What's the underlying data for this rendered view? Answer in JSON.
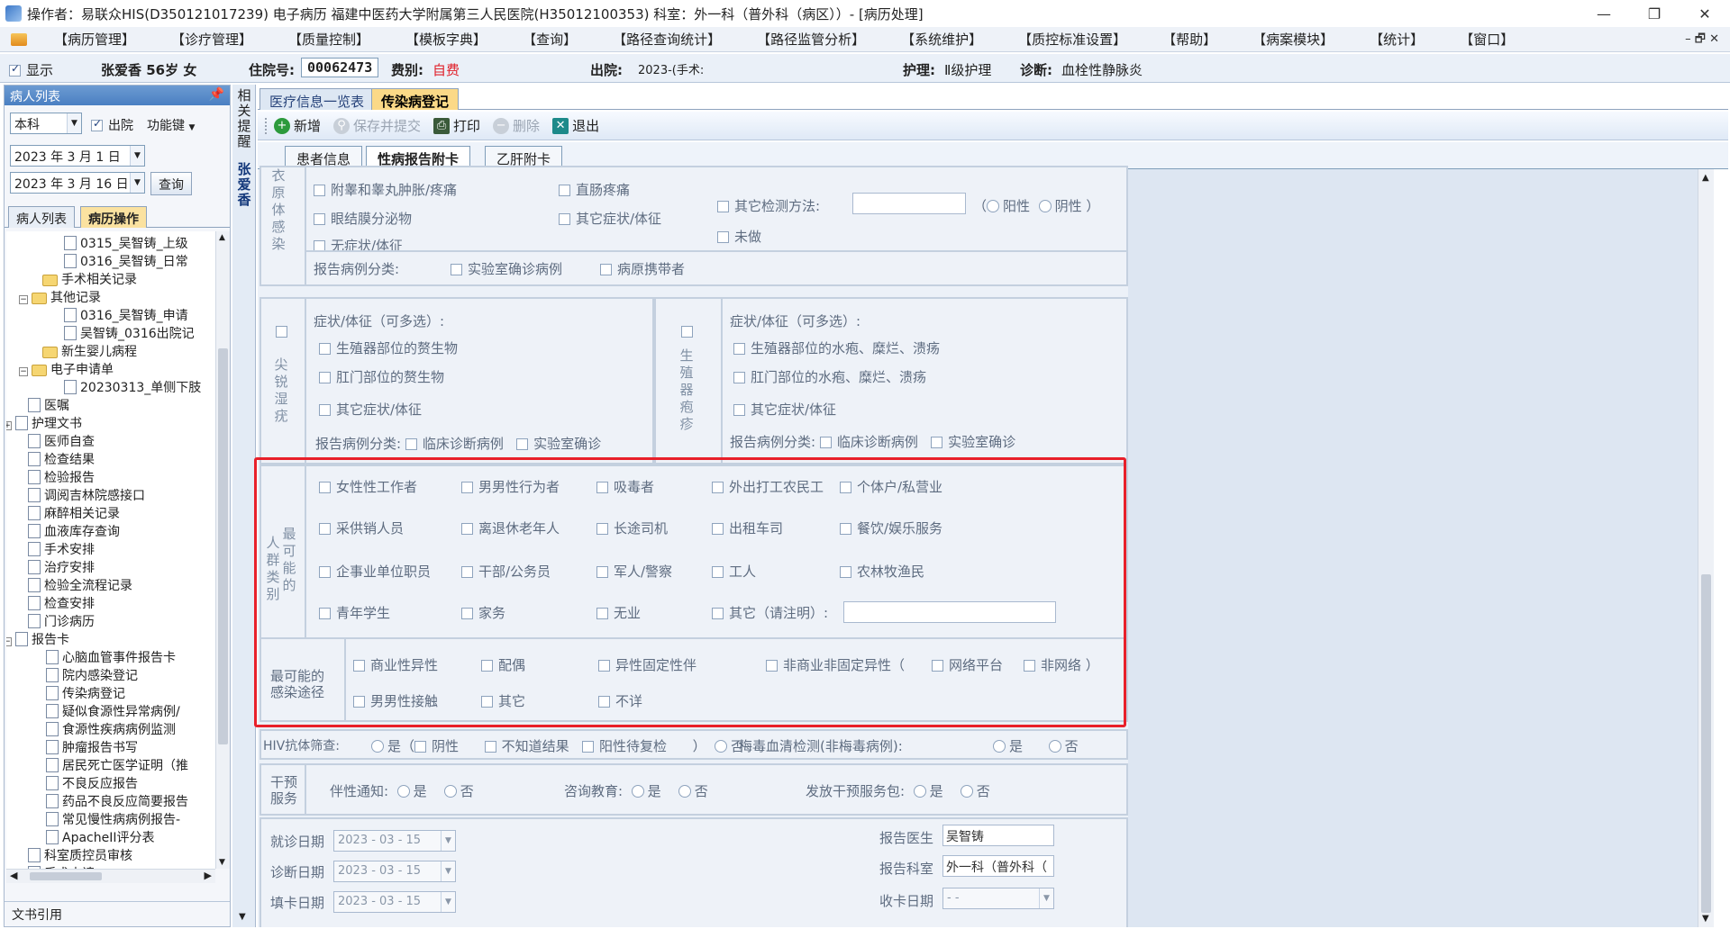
{
  "titlebar": {
    "text": "操作者：易联众HIS(D350121017239) 电子病历  福建中医药大学附属第三人民医院(H35012100353)  科室：外一科（普外科（病区））- [病历处理]",
    "min": "—",
    "restore": "❐",
    "close": "✕"
  },
  "menu": [
    "【病历管理】",
    "【诊疗管理】",
    "【质量控制】",
    "【模板字典】",
    "【查询】",
    "【路径查询统计】",
    "【路径监管分析】",
    "【系统维护】",
    "【质控标准设置】",
    "【帮助】",
    "【病案模块】",
    "【统计】",
    "【窗口】"
  ],
  "mdi_controls": "–  🗗  ✕",
  "patient": {
    "show_label": "显示",
    "name_age": "张爱香  56岁  女",
    "inpatient_no_label": "住院号:",
    "inpatient_no": "00062473",
    "fee_label": "费别:",
    "fee": "自费",
    "discharge_label": "出院:",
    "discharge": "2023-(手术:",
    "nursing_label": "护理:",
    "nursing": "Ⅱ级护理",
    "diagnosis_label": "诊断:",
    "diagnosis": "血栓性静脉炎"
  },
  "left_panel": {
    "title": "病人列表",
    "pin": "📌",
    "dept": "本科",
    "discharged_label": "出院",
    "func_key": "功能键",
    "date_from": "2023 年  3 月  1 日",
    "date_to": "2023 年  3 月 16 日",
    "query": "查询",
    "tab1": "病人列表",
    "tab2": "病历操作",
    "footer": "文书引用",
    "tree": [
      "0315_吴智铸_上级",
      "0316_吴智铸_日常",
      "手术相关记录",
      "其他记录",
      "0316_吴智铸_申请",
      "吴智铸_0316出院记",
      "新生婴儿病程",
      "电子申请单",
      "20230313_单侧下肢",
      "医嘱",
      "护理文书",
      "医师自查",
      "检查结果",
      "检验报告",
      "调阅吉林院感接口",
      "麻醉相关记录",
      "血液库存查询",
      "手术安排",
      "治疗安排",
      "检验全流程记录",
      "检查安排",
      "门诊病历",
      "报告卡",
      "心脑血管事件报告卡",
      "院内感染登记",
      "传染病登记",
      "疑似食源性异常病例/",
      "食源性疾病病例监测",
      "肿瘤报告书写",
      "居民死亡医学证明（推",
      "不良反应报告",
      "药品不良反应简要报告",
      "常见慢性病病例报告-",
      "ApacheII评分表",
      "科室质控员审核",
      "手术申请"
    ]
  },
  "side_strip": {
    "reminder": "相关提醒",
    "patient": "张爱香"
  },
  "main_tabs": [
    "医疗信息一览表",
    "传染病登记"
  ],
  "toolbar": {
    "new": "新增",
    "save": "保存并提交",
    "print": "打印",
    "delete": "删除",
    "exit": "退出"
  },
  "sub_tabs": [
    "患者信息",
    "性病报告附卡",
    "乙肝附卡"
  ],
  "form": {
    "chlamydia": {
      "title": "衣原体感染",
      "s1": "附睾和睾丸肿胀/疼痛",
      "s2": "直肠疼痛",
      "s3": "眼结膜分泌物",
      "s4": "其它症状/体征",
      "s5": "无症状/体征",
      "test_label": "其它检测方法:",
      "positive": "阳性",
      "negative": "阴性",
      "paren_open": "（",
      "paren_close": "）",
      "not_done": "未做",
      "class_label": "报告病例分类:",
      "c1": "实验室确诊病例",
      "c2": "病原携带者"
    },
    "condyloma": {
      "title": "尖锐湿疣",
      "sym_label": "症状/体征（可多选）:",
      "s1": "生殖器部位的赘生物",
      "s2": "肛门部位的赘生物",
      "s3": "其它症状/体征",
      "class_label": "报告病例分类:",
      "c1": "临床诊断病例",
      "c2": "实验室确诊"
    },
    "herpes": {
      "title": "生殖器疱疹",
      "sym_label": "症状/体征（可多选）:",
      "s1": "生殖器部位的水疱、糜烂、溃疡",
      "s2": "肛门部位的水疱、糜烂、溃疡",
      "s3": "其它症状/体征",
      "class_label": "报告病例分类:",
      "c1": "临床诊断病例",
      "c2": "实验室确诊"
    },
    "population": {
      "title_a": "人群类别",
      "title_b": "最可能的",
      "items": [
        "女性性工作者",
        "男男性行为者",
        "吸毒者",
        "外出打工农民工",
        "个体户/私营业",
        "采供销人员",
        "离退休老年人",
        "长途司机",
        "出租车司",
        "餐饮/娱乐服务",
        "企事业单位职员",
        "干部/公务员",
        "军人/警察",
        "工人",
        "农林牧渔民",
        "青年学生",
        "家务",
        "无业",
        "其它（请注明）:"
      ]
    },
    "route": {
      "title": "最可能的感染途径",
      "items": [
        "商业性异性",
        "配偶",
        "异性固定性伴",
        "非商业非固定异性（",
        "网络平台",
        "非网络  ）",
        "男男性接触",
        "其它",
        "不详"
      ]
    },
    "hiv": {
      "label": "HIV抗体筛查:",
      "yes": "是（",
      "neg": "阴性",
      "unknown": "不知道结果",
      "pending": "阳性待复检",
      "close": "）",
      "no": "否",
      "syph_label": "梅毒血清检测(非梅毒病例):",
      "syph_yes": "是",
      "syph_no": "否"
    },
    "intervention": {
      "title": "干预服务",
      "partner": "伴性通知:",
      "consult": "咨询教育:",
      "pack": "发放干预服务包:",
      "yes": "是",
      "no": "否"
    },
    "dates": {
      "visit_label": "就诊日期",
      "visit": "2023 - 03 - 15",
      "diag_label": "诊断日期",
      "diag": "2023 - 03 - 15",
      "fill_label": "填卡日期",
      "fill": "2023 - 03 - 15",
      "doctor_label": "报告医生",
      "doctor": "吴智铸",
      "dept_label": "报告科室",
      "dept": "外一科（普外科（",
      "recv_label": "收卡日期",
      "recv": "  -  -"
    }
  },
  "colors": {
    "highlight_border": "#e8202a",
    "active_tab": "#fbd987",
    "accent": "#4a7fc2"
  }
}
